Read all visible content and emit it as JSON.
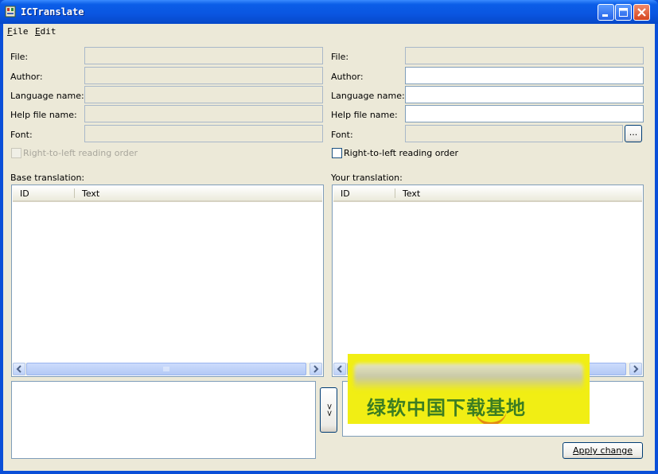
{
  "window": {
    "title": "ICTranslate",
    "controls": [
      "minimize-icon",
      "maximize-icon",
      "close-icon"
    ]
  },
  "menu": [
    "File",
    "Edit"
  ],
  "left": {
    "fields": [
      {
        "label": "File:",
        "value": ""
      },
      {
        "label": "Author:",
        "value": ""
      },
      {
        "label": "Language name:",
        "value": ""
      },
      {
        "label": "Help file name:",
        "value": ""
      },
      {
        "label": "Font:",
        "value": ""
      }
    ],
    "rtl_label": "Right-to-left reading order",
    "rtl_checked": false,
    "list_title": "Base translation:",
    "columns": [
      "ID",
      "Text"
    ],
    "rows": []
  },
  "right": {
    "fields": [
      {
        "label": "File:",
        "value": ""
      },
      {
        "label": "Author:",
        "value": ""
      },
      {
        "label": "Language name:",
        "value": ""
      },
      {
        "label": "Help file name:",
        "value": ""
      },
      {
        "label": "Font:",
        "value": ""
      }
    ],
    "font_browse_label": "...",
    "rtl_label": "Right-to-left reading order",
    "rtl_checked": false,
    "list_title": "Your translation:",
    "columns": [
      "ID",
      "Text"
    ],
    "rows": []
  },
  "copy_button_label": ">>",
  "apply_button_label": "Apply change",
  "watermark_text": "绿软中国下载基地",
  "colors": {
    "titlebar": "#0a55e0",
    "client": "#ece9d8",
    "field_border": "#7f9db9",
    "watermark_bg": "#f1ee14",
    "watermark_text": "#3b7d22"
  }
}
